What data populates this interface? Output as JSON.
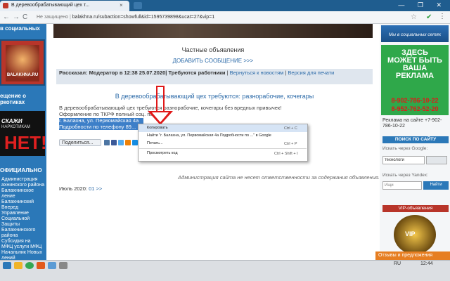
{
  "browser": {
    "tab_title": "В деревообрабатывающий цех т...",
    "tab_close": "×",
    "window_controls": "— ❐ ✕",
    "back": "←",
    "forward": "→",
    "reload": "C",
    "url_security": "Не защищено",
    "url": "balakhna.ru/subaction=showfull&id=1595739898&ucat=27&vip=1",
    "star": "☆",
    "check": "✔",
    "menu": "⋮"
  },
  "left": {
    "header1": "в социальных",
    "logo_text": "BALAKHNA.RU",
    "header2": "ещение о",
    "header2b": "ркотиках",
    "drug_t1": "СКАЖИ",
    "drug_t2": "НАРКОТИКАМ",
    "drug_t3": "НЕТ!",
    "header3": "ОФИЦИАЛЬНО",
    "list": [
      "Администрация",
      "ахнинского района",
      "Балахнинское",
      "ление",
      "Балахнинский Вперед",
      "Управление",
      "Социальной Защиты",
      "Балахнинского района",
      "Субсидия на",
      "",
      "МФЦ услуги МФЦ",
      "Начальник Новых",
      "лений"
    ]
  },
  "main": {
    "private_title": "Частные объявления",
    "add_link": "ДОБАВИТЬ СООБЩЕНИЕ >>>",
    "meta_prefix": "Рассказал: Модератор в 12:38 25.07.2020| Требуются работники",
    "meta_back": "Вернуться к новостям",
    "meta_print": "Версия для печати",
    "ad_title": "В деревообрабатывающий цех требуются: разнорабочие, кочегары",
    "ad_body": "В деревообрабатывающий цех требуются разнорабочие, кочегары без вредных привычек! Оформление по ТКРФ полный соц. пакет.",
    "ad_selected": "г. Балахна, ул. Первомайская 4а Подробности по телефону 89...",
    "share_label": "Поделиться...",
    "disclaimer": "Администрация сайта не несет ответственности за содержания объявления.",
    "archive_label": "Июль 2020:",
    "archive_page": "01 >>"
  },
  "context_menu": {
    "items": [
      {
        "label": "Копировать",
        "shortcut": "Ctrl + C"
      },
      {
        "label": "Найти \"г. Балахна, ул. Первомайская 4а Подробности по ...\" в Google",
        "shortcut": ""
      },
      {
        "label": "Печать...",
        "shortcut": "Ctrl + P"
      },
      {
        "label": "Просмотреть код",
        "shortcut": "Ctrl + Shift + I"
      }
    ]
  },
  "right": {
    "banner1": "Мы в социальных сетях",
    "ad_line1": "ЗДЕСЬ",
    "ad_line2": "МОЖЕТ БЫТЬ",
    "ad_line3": "ВАША",
    "ad_line4": "РЕКЛАМА",
    "phone1": "8-902-786-10-22",
    "phone2": "8-952-762-52-20",
    "ad_note": "Реклама на сайте +7-902-786-10-22",
    "search_header": "ПОИСК ПО САЙТУ",
    "google_label": "Искать через Google:",
    "google_value": "технологи",
    "yandex_label": "Искать через Yandex:",
    "yandex_placeholder": "Ищи",
    "yandex_button": "Найти",
    "vip_header": "VIP-объявления",
    "vip_text": "VIP",
    "feedback": "Отзывы и предложения"
  },
  "taskbar": {
    "lang": "RU",
    "clock": "12:44"
  },
  "colors": {
    "accent": "#2b78b8",
    "arrow": "#e01818",
    "ad_green": "#2fa84a"
  }
}
